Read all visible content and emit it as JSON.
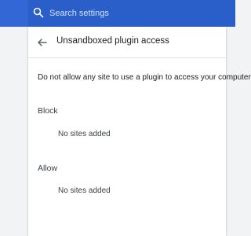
{
  "search": {
    "placeholder": "Search settings",
    "value": ""
  },
  "page": {
    "title": "Unsandboxed plugin access",
    "description": "Do not allow any site to use a plugin to access your computer"
  },
  "sections": {
    "block": {
      "heading": "Block",
      "empty_text": "No sites added"
    },
    "allow": {
      "heading": "Allow",
      "empty_text": "No sites added"
    }
  },
  "colors": {
    "header": "#3367d6",
    "background": "#f1f3f4",
    "card": "#ffffff"
  },
  "icons": {
    "search": "search-icon",
    "back": "arrow-back-icon"
  }
}
